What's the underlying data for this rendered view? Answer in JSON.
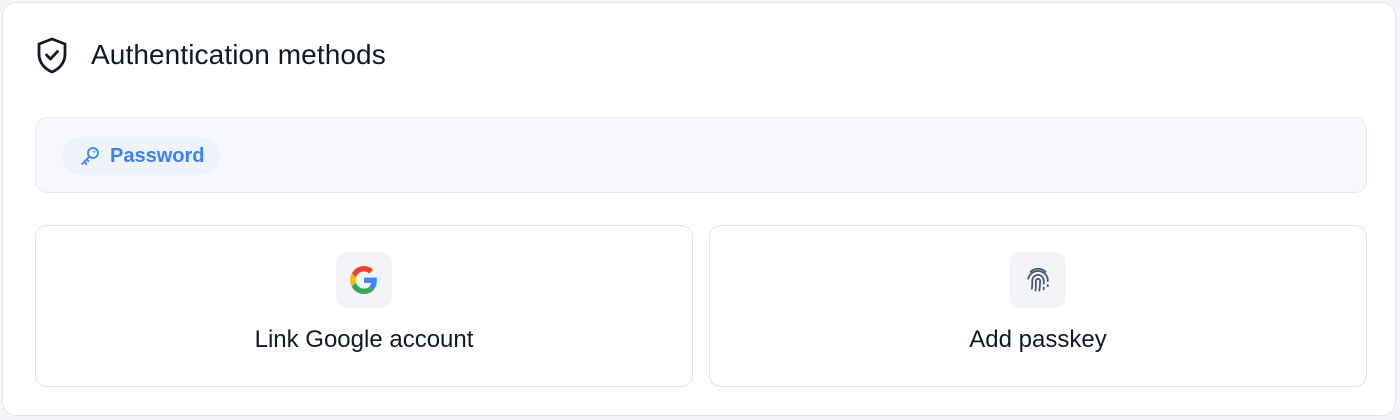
{
  "auth": {
    "title": "Authentication methods",
    "header_icon": "shield-check-icon",
    "methods": [
      {
        "label": "Password",
        "icon": "key-icon"
      }
    ],
    "actions": [
      {
        "label": "Link Google account",
        "icon": "google-icon"
      },
      {
        "label": "Add passkey",
        "icon": "fingerprint-icon"
      }
    ],
    "colors": {
      "accent": "#3b82f6",
      "text": "#111827",
      "card_border": "#dfe5ee",
      "panel_background": "#f6f8fc",
      "chip_background": "#edf2fb"
    }
  }
}
